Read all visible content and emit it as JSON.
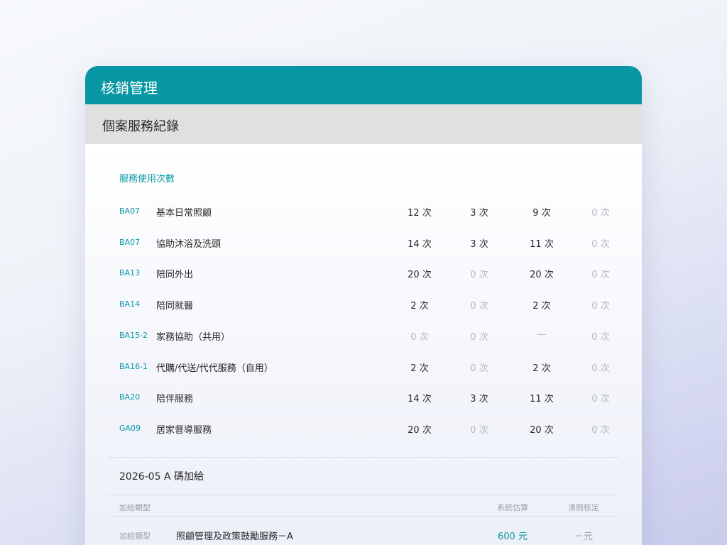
{
  "header": {
    "title": "核銷管理"
  },
  "subheader": {
    "title": "個案服務紀錄"
  },
  "usage": {
    "section_title": "服務使用次數",
    "rows": [
      {
        "code": "BA07",
        "name": "基本日常照顧",
        "c1": "12 次",
        "c2": "3 次",
        "c3": "9 次",
        "c4": "0 次"
      },
      {
        "code": "BA07",
        "name": "協助沐浴及洗頭",
        "c1": "14 次",
        "c2": "3 次",
        "c3": "11 次",
        "c4": "0 次"
      },
      {
        "code": "BA13",
        "name": "陪同外出",
        "c1": "20 次",
        "c2": "0 次",
        "c3": "20 次",
        "c4": "0 次"
      },
      {
        "code": "BA14",
        "name": "陪同就醫",
        "c1": "2 次",
        "c2": "0 次",
        "c3": "2 次",
        "c4": "0 次"
      },
      {
        "code": "BA15-2",
        "name": "家務協助（共用）",
        "c1": "0 次",
        "c2": "0 次",
        "c3": "—",
        "c4": "0 次"
      },
      {
        "code": "BA16-1",
        "name": "代購/代送/代代服務（自用）",
        "c1": "2 次",
        "c2": "0 次",
        "c3": "2 次",
        "c4": "0 次"
      },
      {
        "code": "BA20",
        "name": "陪伴服務",
        "c1": "14 次",
        "c2": "3 次",
        "c3": "11 次",
        "c4": "0 次"
      },
      {
        "code": "GA09",
        "name": "居家督導服務",
        "c1": "20 次",
        "c2": "0 次",
        "c3": "20 次",
        "c4": "0 次"
      }
    ]
  },
  "bonus": {
    "title": "2026-05  A 碼加給",
    "headers": {
      "type": "加給類型",
      "estimate": "系統估算",
      "verified": "清假核定"
    },
    "rows": [
      {
        "type": "加給類型",
        "name": "照顧管理及政策鼓勵服務－A",
        "estimate": "600 元",
        "verified": "－元"
      }
    ]
  }
}
